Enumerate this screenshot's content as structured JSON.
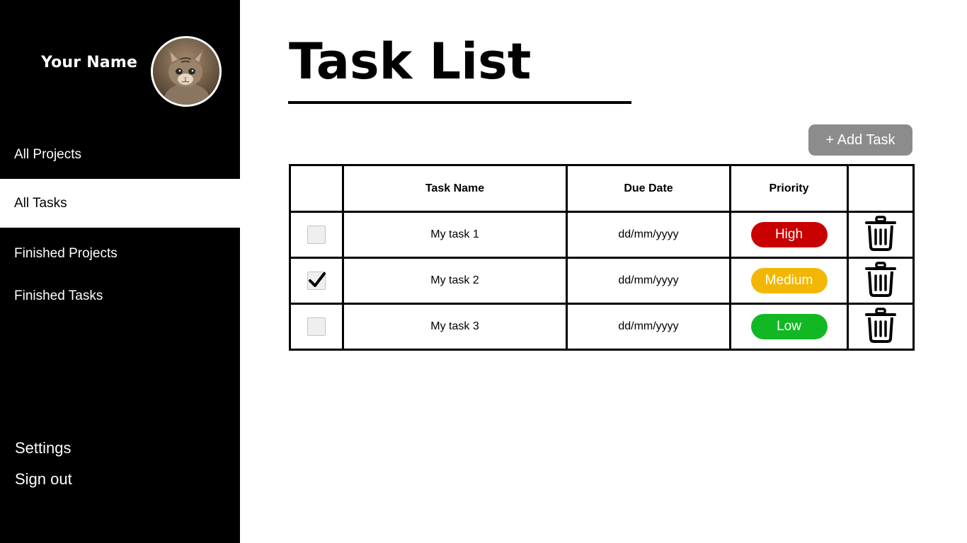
{
  "user": {
    "name": "Your Name",
    "avatar_icon": "cat-photo-avatar"
  },
  "sidebar": {
    "items": [
      {
        "label": "All Projects",
        "active": false
      },
      {
        "label": "All Tasks",
        "active": true
      },
      {
        "label": "Finished Projects",
        "active": false
      },
      {
        "label": "Finished Tasks",
        "active": false
      }
    ],
    "bottom": {
      "settings": "Settings",
      "signout": "Sign out"
    }
  },
  "main": {
    "title": "Task List",
    "add_button_label": "+ Add Task",
    "table": {
      "headers": {
        "check": "",
        "name": "Task Name",
        "due": "Due Date",
        "priority": "Priority",
        "actions": ""
      },
      "rows": [
        {
          "done": false,
          "name": "My task 1",
          "due": "dd/mm/yyyy",
          "priority": "High",
          "priority_color": "#c80000",
          "delete_icon": "trash-icon"
        },
        {
          "done": true,
          "name": "My task 2",
          "due": "dd/mm/yyyy",
          "priority": "Medium",
          "priority_color": "#f2b705",
          "delete_icon": "trash-icon"
        },
        {
          "done": false,
          "name": "My task 3",
          "due": "dd/mm/yyyy",
          "priority": "Low",
          "priority_color": "#12b824",
          "delete_icon": "trash-icon"
        }
      ]
    }
  },
  "colors": {
    "sidebar_bg": "#000000",
    "add_button_bg": "#8c8c8c"
  }
}
